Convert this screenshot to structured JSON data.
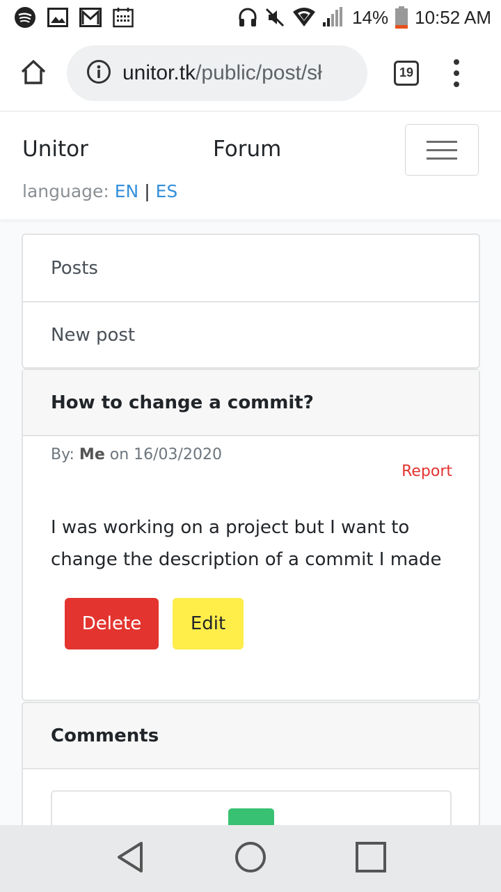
{
  "status_bar": {
    "battery_percent": "14%",
    "time": "10:52 AM",
    "icons": [
      "spotify-icon",
      "gallery-icon",
      "gmail-icon",
      "calendar-icon",
      "headset-icon",
      "mute-icon",
      "wifi-icon",
      "signal-icon",
      "battery-icon"
    ]
  },
  "browser": {
    "url_host": "unitor.tk",
    "url_path": "/public/post/sł",
    "tab_count": "19"
  },
  "navbar": {
    "brand": "Unitor",
    "forum": "Forum",
    "language_label": "language: ",
    "lang_en": "EN",
    "lang_separator": " | ",
    "lang_es": "ES"
  },
  "menu": {
    "items": [
      {
        "label": "Posts"
      },
      {
        "label": "New post"
      }
    ]
  },
  "post": {
    "title": "How to change a commit?",
    "by_label": "By: ",
    "author": "Me",
    "on_label": " on ",
    "date": "16/03/2020",
    "report_label": "Report",
    "body": "I was working on a project but I want to change the description of a commit I made",
    "delete_label": "Delete",
    "edit_label": "Edit"
  },
  "comments": {
    "title": "Comments"
  },
  "colors": {
    "link_blue": "#3490dc",
    "danger_red": "#e3342f",
    "warning_yellow": "#ffed4a",
    "success_green": "#38c172"
  }
}
